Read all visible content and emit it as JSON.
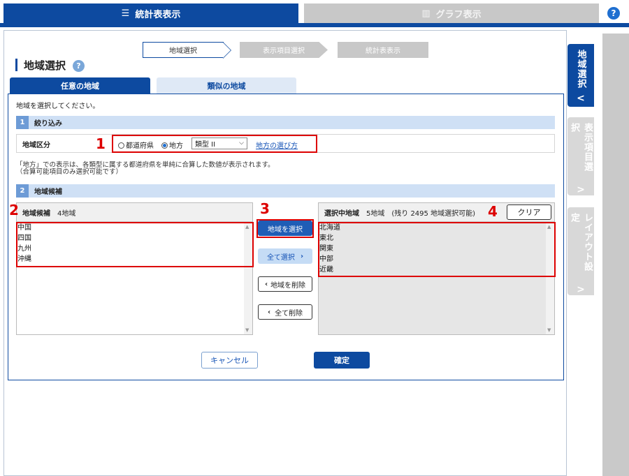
{
  "top_tabs": {
    "stats": "統計表表示",
    "graph": "グラフ表示",
    "help": "?"
  },
  "side_tabs": [
    {
      "label": "地域選択",
      "chev": "<"
    },
    {
      "label": "表示項目選択",
      "chev": ">"
    },
    {
      "label": "レイアウト設定",
      "chev": ">"
    }
  ],
  "steps": [
    "地域選択",
    "表示項目選択",
    "統計表表示"
  ],
  "heading": "地域選択",
  "area_tabs": [
    "任意の地域",
    "類似の地域"
  ],
  "instruction": "地域を選択してください。",
  "section1": {
    "num": "1",
    "title": "絞り込み"
  },
  "filter": {
    "label": "地域区分",
    "radio1": "都道府県",
    "radio2": "地方",
    "select_value": "類型 II",
    "link": "地方の選び方"
  },
  "note": {
    "line1": "「地方」での表示は、各類型に属する都道府県を単純に合算した数値が表示されます。",
    "line2": "（合算可能項目のみ選択可能です）"
  },
  "section2": {
    "num": "2",
    "title": "地域候補"
  },
  "candidates": {
    "title": "地域候補",
    "count": "4地域",
    "items": [
      "中国",
      "四国",
      "九州",
      "沖縄"
    ]
  },
  "selected": {
    "title": "選択中地域",
    "count": "5地域　(残り 2495 地域選択可能)",
    "items": [
      "北海道",
      "東北",
      "関東",
      "中部",
      "近畿"
    ],
    "clear": "クリア"
  },
  "buttons": {
    "select": "地域を選択",
    "select_all": "全て選択",
    "remove": "地域を削除",
    "remove_all": "全て削除",
    "cancel": "キャンセル",
    "ok": "確定"
  },
  "annotations": [
    "1",
    "2",
    "3",
    "4"
  ]
}
